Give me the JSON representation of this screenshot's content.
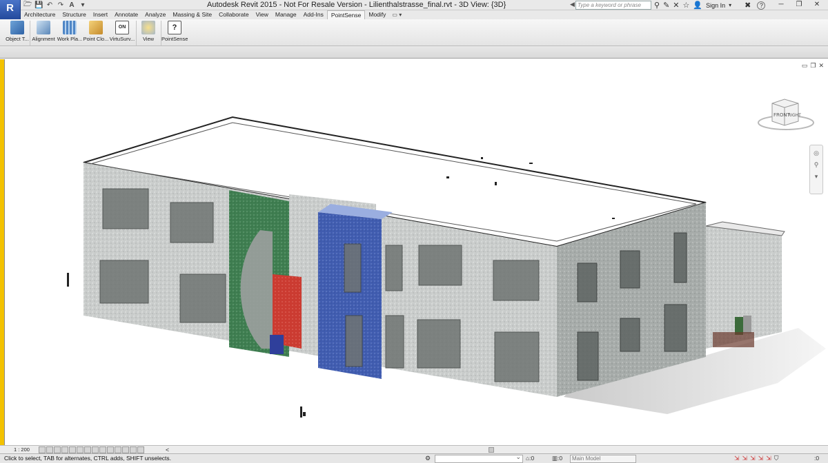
{
  "window": {
    "title": "Autodesk Revit 2015 -  Not For Resale Version -     Lilienthalstrasse_final.rvt - 3D View: {3D}",
    "app_button": "R",
    "search_placeholder": "Type a keyword or phrase",
    "sign_in": "Sign In",
    "help": "?"
  },
  "tabs": [
    "Architecture",
    "Structure",
    "Insert",
    "Annotate",
    "Analyze",
    "Massing & Site",
    "Collaborate",
    "View",
    "Manage",
    "Add-Ins",
    "PointSense",
    "Modify"
  ],
  "active_tab": "PointSense",
  "ribbon_buttons": [
    {
      "label": "Object T...",
      "icon": "object-tool-icon"
    },
    {
      "label": "Alignment",
      "icon": "alignment-icon"
    },
    {
      "label": "Work Pla...",
      "icon": "work-plane-icon"
    },
    {
      "label": "Point Clo...",
      "icon": "point-cloud-icon"
    },
    {
      "label": "VirtuSurv...",
      "icon": "virtusurv-icon",
      "badge": "ON"
    },
    {
      "label": "View",
      "icon": "view-icon"
    },
    {
      "label": "PointSense",
      "icon": "help-icon",
      "glyph": "?"
    }
  ],
  "viewcube": {
    "front": "FRONT",
    "right": "RIGHT"
  },
  "viewbar": {
    "scale": "1 : 200"
  },
  "statusbar": {
    "hint": "Click to select, TAB for alternates, CTRL adds, SHIFT unselects.",
    "counter1": ":0",
    "counter2": ":0",
    "model": "Main Model",
    "filter_count": ":0"
  },
  "colors": {
    "accent": "#22489b",
    "active_tab": "#f6f6f6",
    "green_panel": "#3a7a4e",
    "blue_panel": "#3d5aa8",
    "red_panel": "#c83a32"
  }
}
